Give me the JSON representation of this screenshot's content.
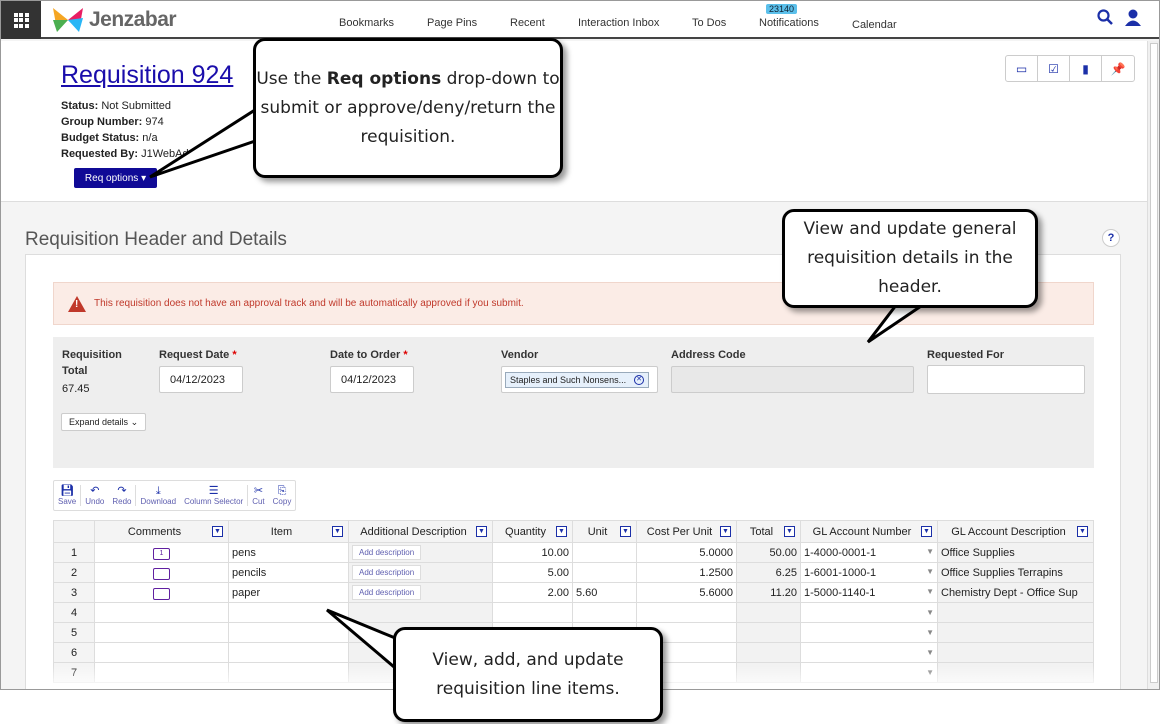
{
  "topbar": {
    "logo": "Jenzabar",
    "nav": [
      "Bookmarks",
      "Page Pins",
      "Recent",
      "Interaction Inbox",
      "To Dos",
      "Notifications",
      "Calendar"
    ],
    "notification_count": "23140"
  },
  "header": {
    "title": "Requisition 924",
    "status_label": "Status:",
    "status": "Not Submitted",
    "group_label": "Group Number:",
    "group": "974",
    "budget_label": "Budget Status:",
    "budget": "n/a",
    "requested_label": "Requested By:",
    "requested_by": "J1WebAd",
    "req_options": "Req options"
  },
  "section": {
    "title": "Requisition Header and Details",
    "help": "?"
  },
  "alert": "This requisition does not have an approval track and will be automatically approved if you submit.",
  "form": {
    "total_label1": "Requisition",
    "total_label2": "Total",
    "total": "67.45",
    "request_date_label": "Request Date",
    "request_date": "04/12/2023",
    "date_to_order_label": "Date to Order",
    "date_to_order": "04/12/2023",
    "vendor_label": "Vendor",
    "vendor": "Staples and Such Nonsens...",
    "address_label": "Address Code",
    "requested_for_label": "Requested For",
    "expand": "Expand details"
  },
  "toolbar": [
    "Save",
    "Undo",
    "Redo",
    "Download",
    "Column Selector",
    "Cut",
    "Copy"
  ],
  "table": {
    "columns": [
      "Comments",
      "Item",
      "Additional Description",
      "Quantity",
      "Unit",
      "Cost Per Unit",
      "Total",
      "GL Account Number",
      "GL Account Description"
    ],
    "add_description": "Add description",
    "rows": [
      {
        "n": "1",
        "comments": "1",
        "item": "pens",
        "qty": "10.00",
        "unit": "",
        "cost": "5.0000",
        "total": "50.00",
        "gl": "1-4000-0001-1",
        "gldesc": "Office Supplies"
      },
      {
        "n": "2",
        "comments": "",
        "item": "pencils",
        "qty": "5.00",
        "unit": "",
        "cost": "1.2500",
        "total": "6.25",
        "gl": "1-6001-1000-1",
        "gldesc": "Office Supplies Terrapins"
      },
      {
        "n": "3",
        "comments": "",
        "item": "paper",
        "qty": "2.00",
        "unit": "5.60",
        "cost": "5.6000",
        "total": "11.20",
        "gl": "1-5000-1140-1",
        "gldesc": "Chemistry Dept - Office Sup"
      }
    ],
    "empty_rows": [
      "4",
      "5",
      "6",
      "7"
    ]
  },
  "callouts": {
    "req_pre": "Use the ",
    "req_bold": "Req options",
    "req_post": " drop-down to submit or approve/deny/return the requisition.",
    "header": "View and update general requisition details in the header.",
    "lines": "View, add, and update requisition line items."
  }
}
